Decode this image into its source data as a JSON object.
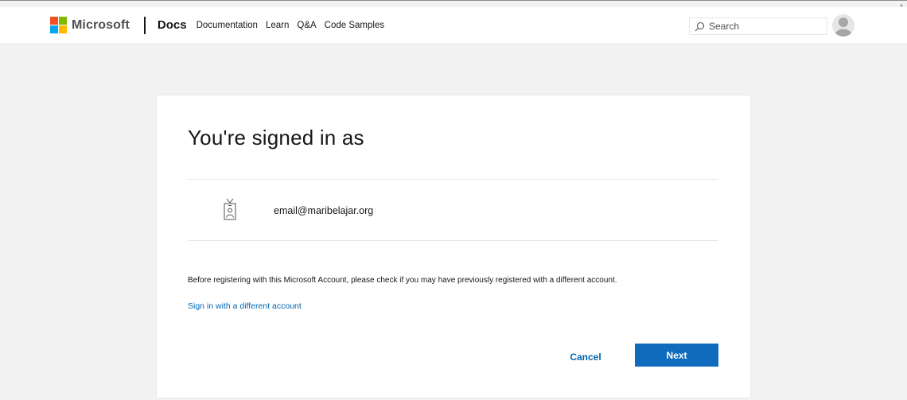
{
  "header": {
    "brand": "Microsoft",
    "product": "Docs",
    "nav": [
      "Documentation",
      "Learn",
      "Q&A",
      "Code Samples"
    ],
    "search_placeholder": "Search",
    "logo_colors": [
      "#f25022",
      "#7fba00",
      "#00a4ef",
      "#ffb900"
    ]
  },
  "card": {
    "title": "You're signed in as",
    "email": "email@maribelajar.org",
    "info_text": "Before registering with this Microsoft Account, please check if you may have previously registered with a different account.",
    "switch_link": "Sign in with a different account",
    "cancel_label": "Cancel",
    "next_label": "Next"
  },
  "icons": {
    "search": "search-icon",
    "avatar": "user-avatar-icon",
    "badge": "id-badge-icon"
  },
  "colors": {
    "accent": "#0f6cbd",
    "link": "#0065b3",
    "page_bg": "#f2f2f2"
  }
}
